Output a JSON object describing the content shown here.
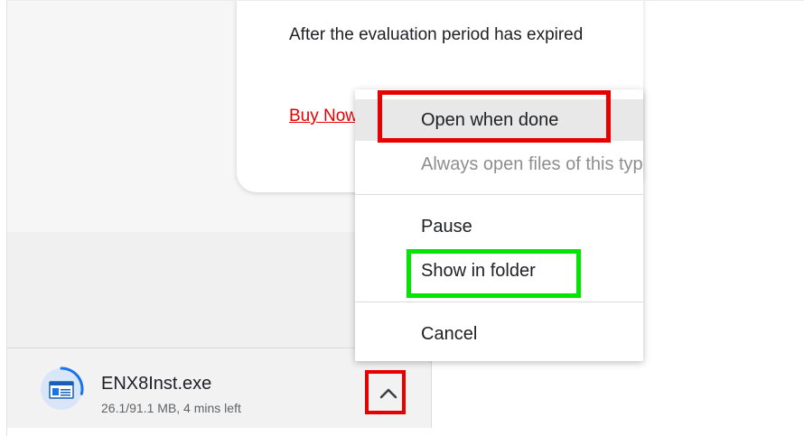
{
  "page": {
    "card_text": "After the evaluation period has expired",
    "buy_link": "Buy Now"
  },
  "context_menu": {
    "items": [
      {
        "label": "Open when done",
        "state": "hovered"
      },
      {
        "label": "Always open files of this type",
        "state": "disabled"
      },
      {
        "label": "Pause",
        "state": "normal"
      },
      {
        "label": "Show in folder",
        "state": "normal"
      },
      {
        "label": "Cancel",
        "state": "normal"
      }
    ]
  },
  "download": {
    "file_name": "ENX8Inst.exe",
    "status": "26.1/91.1 MB, 4 mins left",
    "progress_fraction": 0.287,
    "icon": "installer-file-icon",
    "expand_icon": "chevron-up-icon"
  },
  "highlights": {
    "red": "#e60000",
    "green": "#00e600"
  }
}
